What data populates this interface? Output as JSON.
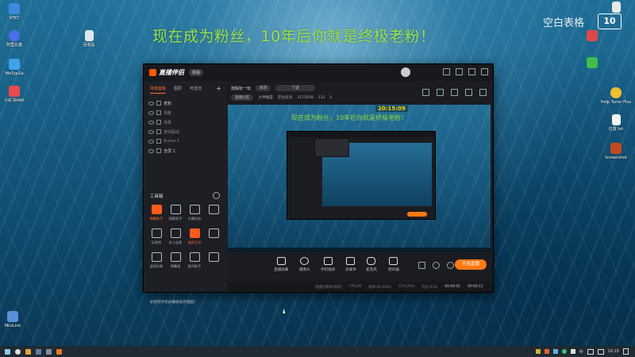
{
  "desktop": {
    "headline": "现在成为粉丝，10年后你就是终极老粉！",
    "top_right_text": "空白表格",
    "top_right_logo": "10",
    "left_icons": [
      {
        "label": "KTKT",
        "icon": "app-icon",
        "color": "#3a8be0"
      },
      {
        "label": "阿里云盘",
        "icon": "cloud-icon",
        "color": "#4a6ee8"
      },
      {
        "label": "WeTypGo",
        "icon": "network-icon",
        "color": "#3fa2e8"
      },
      {
        "label": "小红书ARK",
        "icon": "app-icon",
        "color": "#e84a4a"
      },
      {
        "label": "MiniLink",
        "icon": "computer-icon",
        "color": "#5a8fd8"
      }
    ],
    "recycle_icon": {
      "label": "回收站",
      "icon": "recycle-bin-icon"
    },
    "right_icons": [
      {
        "label": "",
        "icon": "document-icon",
        "color": "#e8e8e8"
      },
      {
        "label": "",
        "icon": "app-icon",
        "color": "#e04848"
      },
      {
        "label": "",
        "icon": "app-icon",
        "color": "#3fbf4a"
      },
      {
        "label": "Help Tuner Plus",
        "icon": "help-icon",
        "color": "#f0c030"
      },
      {
        "label": "位置.txt",
        "icon": "text-file-icon",
        "color": "#f4f4f4"
      },
      {
        "label": "Screenshot",
        "icon": "app-icon",
        "color": "#c04a20"
      }
    ]
  },
  "app": {
    "name": "直播伴侣",
    "version_badge": "新版",
    "left_tabs": [
      "场景面板",
      "图层",
      "可选流"
    ],
    "scenes": [
      "老粉",
      "场景",
      "场景",
      "游戏联动",
      "Scene 1",
      "全屏 1"
    ],
    "tools_title": "工具箱",
    "tools": [
      {
        "label": "弹幕助手",
        "hot": true
      },
      {
        "label": "观察助手",
        "hot": false
      },
      {
        "label": "主播任务",
        "hot": false
      },
      {
        "label": "",
        "hot": false
      },
      {
        "label": "玩游戏",
        "hot": false
      },
      {
        "label": "多人连麦",
        "hot": false
      },
      {
        "label": "抽奖活动",
        "hot": true
      },
      {
        "label": "",
        "hot": false
      },
      {
        "label": "虚拟形象",
        "hot": false
      },
      {
        "label": "弹幕姬",
        "hot": false
      },
      {
        "label": "歌词助手",
        "hot": false
      },
      {
        "label": "",
        "hot": false
      }
    ],
    "hint": "如何把手机屏幕投屏到电脑?",
    "room_title": "放假玩一玩",
    "room_tag": "修改",
    "room_category": "下游",
    "room_meta": [
      "直播分区",
      "大神联盟",
      "定位房间",
      "3175928",
      "233",
      "0"
    ],
    "preview_headline": "现在成为粉丝，10年后你就是终极老粉！",
    "preview_clock": "20:15:09",
    "bottom_tools": [
      "直播屏幕",
      "摄像头",
      "手机投屏",
      "多媒体",
      "麦克风",
      "扬声器"
    ],
    "start_live": "开始直播",
    "status": [
      "直播分辨率(帧率)",
      "FPS:60",
      "帧率(60.00%)",
      "CPU:26%",
      "内存:53%",
      "00:00:01",
      "00:00:11"
    ]
  },
  "taskbar": {
    "time": "10:15",
    "tray_label": "中"
  }
}
